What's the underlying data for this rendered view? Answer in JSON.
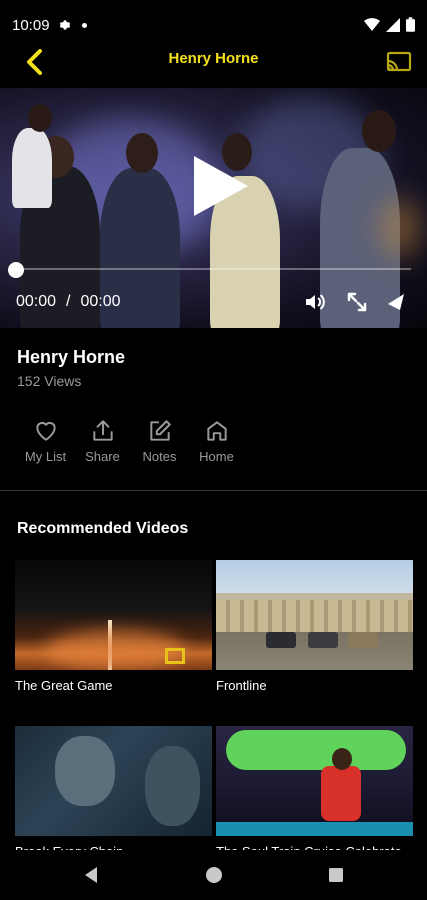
{
  "status_bar": {
    "time": "10:09"
  },
  "header": {
    "title": "Henry Horne",
    "back_icon": "chevron-left-icon",
    "cast_icon": "cast-icon",
    "accent": "#f3e01a"
  },
  "player": {
    "current_time": "00:00",
    "separator": "/",
    "duration": "00:00",
    "progress": 0
  },
  "video": {
    "title": "Henry Horne",
    "views": "152 Views"
  },
  "actions": [
    {
      "label": "My List",
      "icon": "heart-icon"
    },
    {
      "label": "Share",
      "icon": "share-icon"
    },
    {
      "label": "Notes",
      "icon": "edit-icon"
    },
    {
      "label": "Home",
      "icon": "home-icon"
    }
  ],
  "recommended": {
    "title": "Recommended Videos",
    "items": [
      {
        "title": "The Great Game"
      },
      {
        "title": "Frontline"
      },
      {
        "title": "Break Every Chain"
      },
      {
        "title": "The Soul Train Cruise Celebrate"
      }
    ]
  }
}
